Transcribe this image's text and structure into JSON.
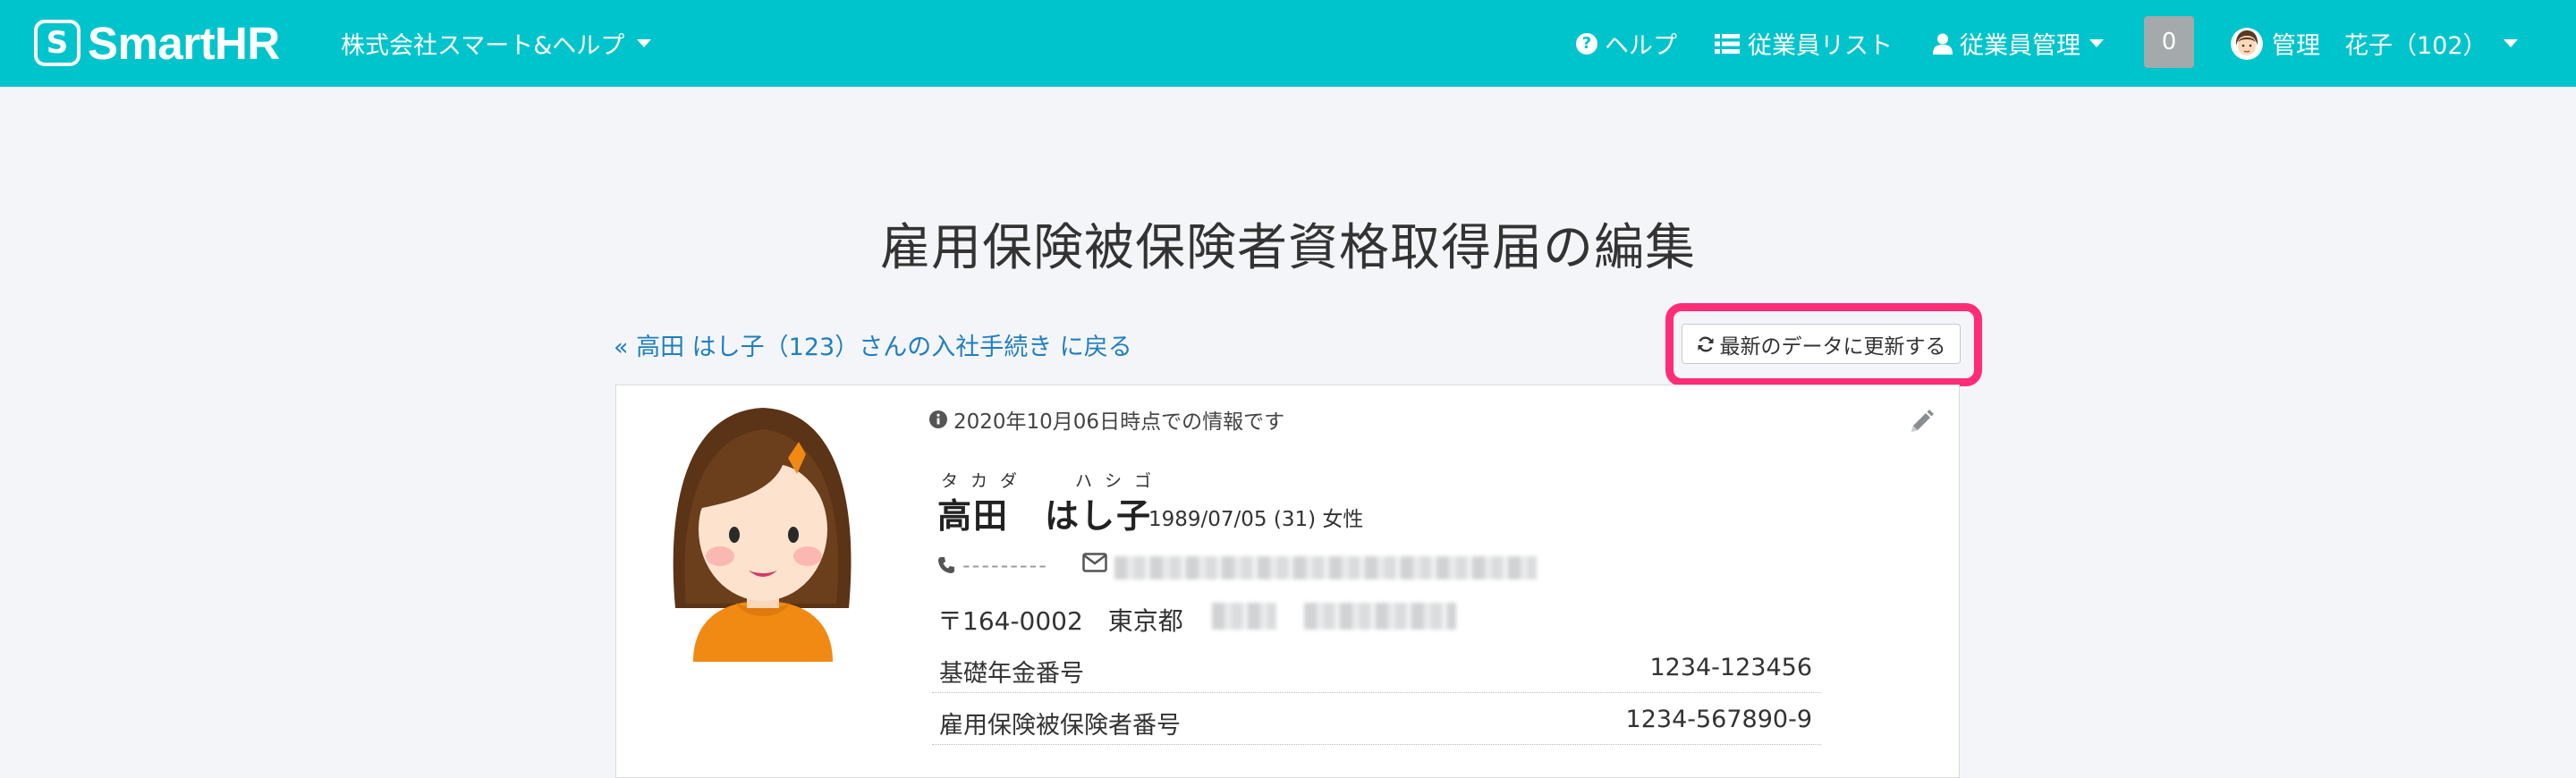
{
  "header": {
    "logo_mark": "S",
    "logo_text": "SmartHR",
    "company": "株式会社スマート&ヘルプ",
    "help": "ヘルプ",
    "employee_list": "従業員リスト",
    "employee_admin": "従業員管理",
    "notification_count": "0",
    "user": "管理　花子（102）"
  },
  "page": {
    "title": "雇用保険被保険者資格取得届の編集",
    "back_link": "« 高田 はし子（123）さんの入社手続き に戻る",
    "refresh_button": "最新のデータに更新する"
  },
  "profile": {
    "as_of": "2020年10月06日時点での情報です",
    "ruby_last": "タカダ",
    "ruby_first": "ハシゴ",
    "name": "高田　はし子",
    "birth_info": "1989/07/05 (31)  女性",
    "phone": "---------",
    "postal": "〒164-0002　東京都",
    "rows": [
      {
        "label": "基礎年金番号",
        "value": "1234-123456"
      },
      {
        "label": "雇用保険被保険者番号",
        "value": "1234-567890-9"
      }
    ]
  },
  "colors": {
    "header_bg": "#00c4cc",
    "highlight": "#ff2c77",
    "link": "#1f7fc0"
  }
}
